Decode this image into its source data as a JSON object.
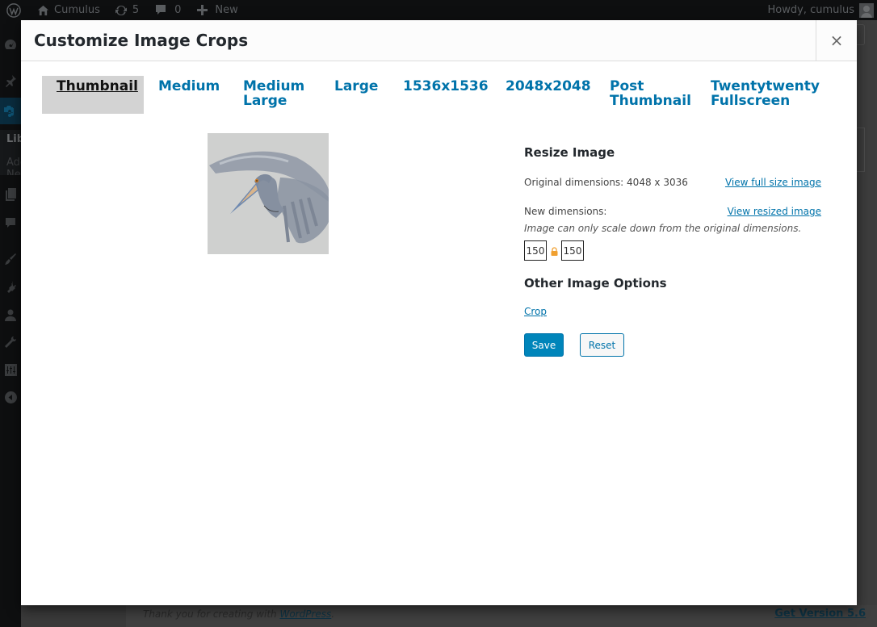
{
  "adminbar": {
    "site_name": "Cumulus",
    "updates_count": "5",
    "comments_count": "0",
    "new_label": "New",
    "greeting": "Howdy, cumulus"
  },
  "sidebar": {
    "items": [
      {
        "icon": "dashboard-icon"
      },
      {
        "icon": "pin-icon"
      },
      {
        "icon": "media-icon",
        "active": true
      },
      {
        "icon": "pages-icon"
      },
      {
        "icon": "comments-icon"
      },
      {
        "icon": "appearance-icon"
      },
      {
        "icon": "plugins-icon"
      },
      {
        "icon": "users-icon"
      },
      {
        "icon": "tools-icon"
      },
      {
        "icon": "settings-icon"
      },
      {
        "icon": "collapse-icon"
      }
    ],
    "submenu": {
      "library_label": "Library",
      "add_new_label": "Add New"
    }
  },
  "modal": {
    "title": "Customize Image Crops",
    "close_icon": "×",
    "tabs": [
      {
        "line1": "Thumbnail",
        "line2": "",
        "active": true
      },
      {
        "line1": "Medium",
        "line2": ""
      },
      {
        "line1": "Medium",
        "line2": "Large"
      },
      {
        "line1": "Large",
        "line2": ""
      },
      {
        "line1": "1536x1536",
        "line2": ""
      },
      {
        "line1": "2048x2048",
        "line2": ""
      },
      {
        "line1": "Post",
        "line2": "Thumbnail"
      },
      {
        "line1": "Twentytwenty",
        "line2": "Fullscreen"
      }
    ],
    "image_alt": "Heron painting thumbnail",
    "resize": {
      "heading": "Resize Image",
      "original_label": "Original dimensions: 4048 x 3036",
      "view_full_link": "View full size image",
      "new_label": "New dimensions:",
      "view_resized_link": "View resized image",
      "note": "Image can only scale down from the original dimensions.",
      "width_value": "150",
      "height_value": "150"
    },
    "other": {
      "heading": "Other Image Options",
      "crop_link": "Crop",
      "save_label": "Save",
      "reset_label": "Reset"
    }
  },
  "footer": {
    "thanks_prefix": "Thank you for creating with ",
    "wordpress_link": "WordPress",
    "thanks_suffix": ".",
    "version_link": "Get Version 5.6"
  },
  "colors": {
    "accent": "#0073aa",
    "button_primary": "#0085ba",
    "lock": "#f0a030"
  }
}
